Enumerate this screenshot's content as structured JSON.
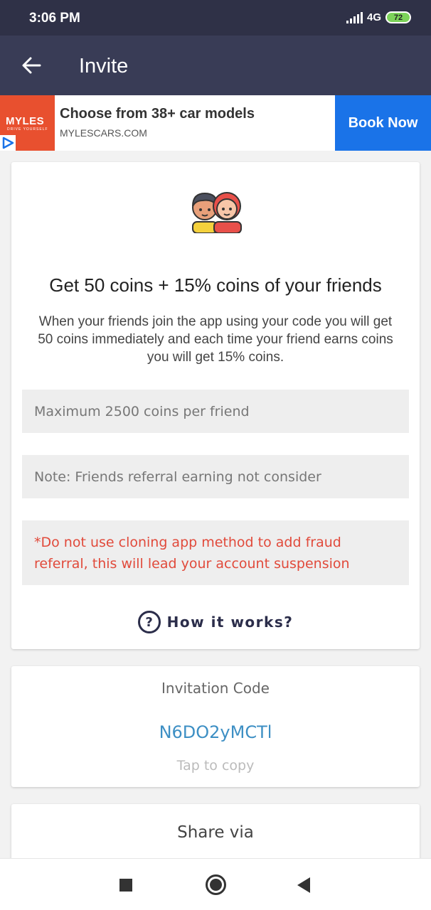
{
  "status_bar": {
    "time": "3:06 PM",
    "network": "4G",
    "battery": "72"
  },
  "app_bar": {
    "title": "Invite",
    "back_icon": "arrow-left-icon"
  },
  "ad": {
    "logo_text": "MYLES",
    "logo_tagline": "DRIVE YOURSELF",
    "headline": "Choose from 38+ car models",
    "url": "MYLESCARS.COM",
    "cta": "Book Now",
    "brand_color": "#e8502f",
    "cta_color": "#1a73e8"
  },
  "invite_card": {
    "illustration": "two-friends-icon",
    "headline": "Get 50 coins + 15% coins of your friends",
    "description": "When your friends join the app using your code you will get 50 coins immediately and each time your friend earns coins you will get 15% coins.",
    "max_note": "Maximum 2500 coins per friend",
    "referral_note": "Note: Friends referral earning not consider",
    "warning": "*Do not use cloning app method to add fraud referral, this will lead your account suspension",
    "how_it_works": "How it works?",
    "warning_color": "#e14a3b"
  },
  "invitation": {
    "label": "Invitation Code",
    "code": "N6DO2yMCTl",
    "copy_hint": "Tap to copy",
    "code_color": "#3d8fc4"
  },
  "share": {
    "label": "Share via"
  },
  "nav": {
    "recents": "square-icon",
    "home": "circle-home-icon",
    "back": "triangle-back-icon"
  }
}
